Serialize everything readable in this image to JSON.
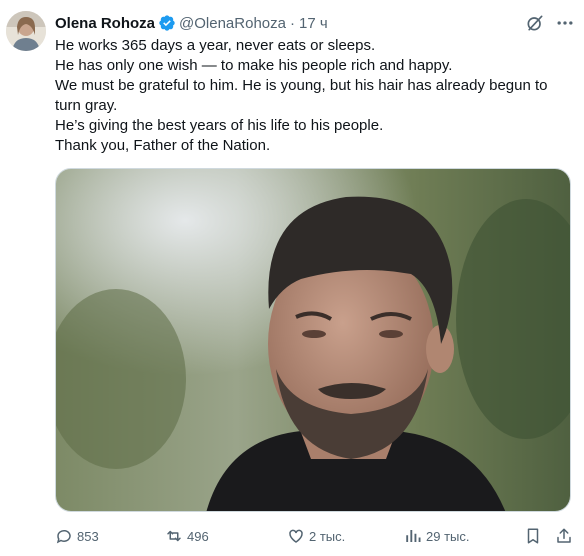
{
  "author": {
    "name": "Olena Rohoza",
    "handle": "@OlenaRohoza",
    "separator": "·",
    "time": "17 ч"
  },
  "tweet": {
    "lines": [
      "He works 365 days a year, never eats or sleeps.",
      "He has only one wish — to make his people rich and happy.",
      "We must be grateful to him. He is young, but his hair has already begun to turn gray.",
      "He’s giving the best years of his life to his people.",
      "Thank you, Father of the Nation."
    ]
  },
  "actions": {
    "replies": "853",
    "reposts": "496",
    "likes": "2 тыс.",
    "views": "29 тыс."
  },
  "icons": {
    "verified": "verified-badge-icon",
    "grok": "grok-icon",
    "more": "more-icon",
    "reply": "reply-icon",
    "repost": "repost-icon",
    "like": "heart-icon",
    "views": "views-icon",
    "bookmark": "bookmark-icon",
    "share": "share-icon"
  },
  "colors": {
    "accent": "#1d9bf0",
    "text": "#0f1419",
    "secondary": "#536471"
  }
}
